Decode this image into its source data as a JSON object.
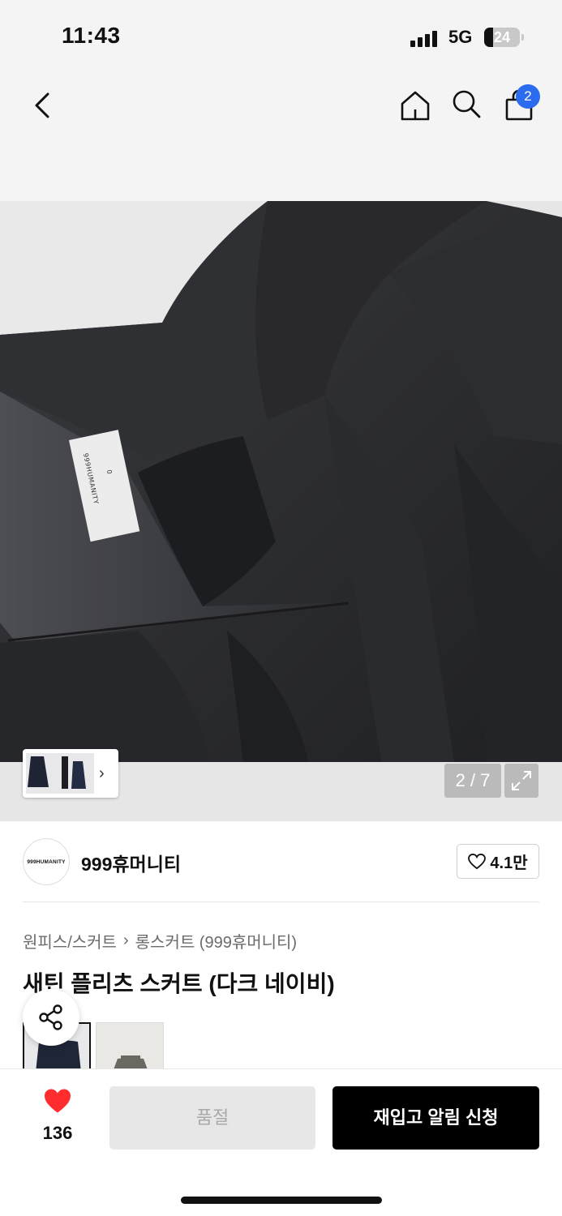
{
  "status_bar": {
    "time": "11:43",
    "network": "5G",
    "battery": "24",
    "battery_level_percent": 24
  },
  "header": {
    "icons": [
      "back-icon",
      "home-icon",
      "search-icon",
      "cart-icon"
    ],
    "cart_badge": "2",
    "badge_color": "#2b6bf0"
  },
  "gallery": {
    "counter": "2 / 7",
    "thumbnail_more": "›"
  },
  "brand": {
    "logo_text": "999HUMANITY",
    "name": "999휴머니티",
    "likes": "4.1만"
  },
  "product": {
    "breadcrumb": [
      "원피스/스커트",
      "롱스커트 (999휴머니티)"
    ],
    "breadcrumb_sep": "›",
    "title": "새틴 플리츠 스커트 (다크 네이비)",
    "label_text": "999HUMANITY",
    "label_size": "0"
  },
  "actions": {
    "wish_count": "136",
    "soldout_label": "품절",
    "restock_label": "재입고 알림 신청",
    "heart_color": "#ff2d2d"
  }
}
